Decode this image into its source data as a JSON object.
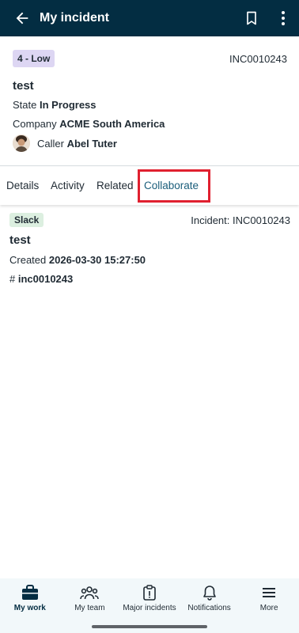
{
  "app_bar": {
    "title": "My incident"
  },
  "incident": {
    "priority": "4 - Low",
    "number": "INC0010243",
    "short_description": "test",
    "state_label": "State",
    "state_value": "In Progress",
    "company_label": "Company",
    "company_value": "ACME South America",
    "caller_label": "Caller",
    "caller_value": "Abel Tuter"
  },
  "tabs": [
    {
      "label": "Details"
    },
    {
      "label": "Activity"
    },
    {
      "label": "Related"
    },
    {
      "label": "Collaborate"
    }
  ],
  "active_tab": "Collaborate",
  "collaborate": {
    "badge": "Slack",
    "incident_ref": "Incident: INC0010243",
    "title": "test",
    "created_label": "Created",
    "created_value": "2026-03-30 15:27:50",
    "channel_prefix": "#",
    "channel_value": "inc0010243"
  },
  "bottom_nav": [
    {
      "label": "My work",
      "icon": "briefcase-icon"
    },
    {
      "label": "My team",
      "icon": "team-icon"
    },
    {
      "label": "Major incidents",
      "icon": "clipboard-alert-icon"
    },
    {
      "label": "Notifications",
      "icon": "bell-icon"
    },
    {
      "label": "More",
      "icon": "menu-icon"
    }
  ],
  "colors": {
    "app_bar": "#032d42",
    "priority_badge": "#ddd6f3",
    "slack_badge": "#dcefe0",
    "highlight": "#e0202f",
    "active_tab": "#1a5d7a"
  }
}
